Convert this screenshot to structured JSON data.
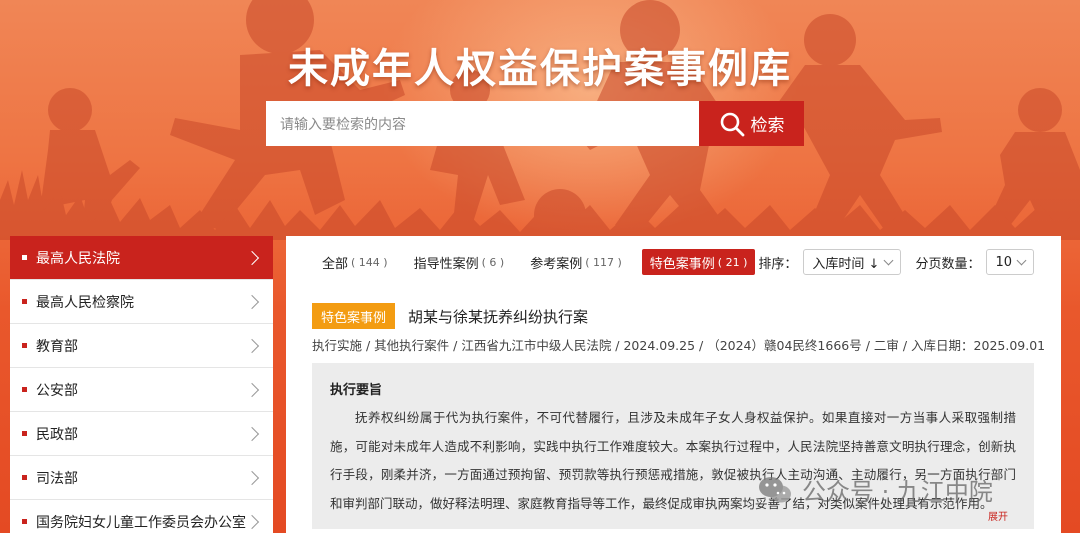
{
  "header": {
    "title": "未成年人权益保护案事例库",
    "search_placeholder": "请输入要检索的内容",
    "search_button": "检索"
  },
  "sidebar": {
    "items": [
      {
        "label": "最高人民法院",
        "active": true
      },
      {
        "label": "最高人民检察院"
      },
      {
        "label": "教育部"
      },
      {
        "label": "公安部"
      },
      {
        "label": "民政部"
      },
      {
        "label": "司法部"
      },
      {
        "label": "国务院妇女儿童工作委员会办公室"
      }
    ]
  },
  "tabs": [
    {
      "label": "全部",
      "count": "( 144 )"
    },
    {
      "label": "指导性案例",
      "count": "( 6 )"
    },
    {
      "label": "参考案例",
      "count": "( 117 )"
    },
    {
      "label": "特色案事例",
      "count": "( 21 )",
      "active": true
    }
  ],
  "sort": {
    "label": "排序：",
    "value": "入库时间 ↓",
    "page_size_label": "分页数量：",
    "page_size_value": "10"
  },
  "case": {
    "badge": "特色案事例",
    "title": "胡某与徐某抚养纠纷执行案",
    "meta": "执行实施 / 其他执行案件 / 江西省九江市中级人民法院 / 2024.09.25 / （2024）赣04民终1666号 / 二审 / 入库日期：2025.09.01",
    "summary_title": "执行要旨",
    "summary_text": "抚养权纠纷属于代为执行案件，不可代替履行，且涉及未成年子女人身权益保护。如果直接对一方当事人采取强制措施，可能对未成年人造成不利影响，实践中执行工作难度较大。本案执行过程中，人民法院坚持善意文明执行理念，创新执行手段，刚柔并济，一方面通过预拘留、预罚款等执行预惩戒措施，敦促被执行人主动沟通、主动履行，另一方面执行部门和审判部门联动，做好释法明理、家庭教育指导等工作，最终促成审执两案均妥善了结，对类似案件处理具有示范作用。",
    "expand": "展开"
  },
  "watermark": {
    "text": "公众号 · 九江中院"
  },
  "colors": {
    "accent_red": "#c9231d",
    "badge_orange": "#f39c12",
    "banner_orange": "#ee7443"
  }
}
